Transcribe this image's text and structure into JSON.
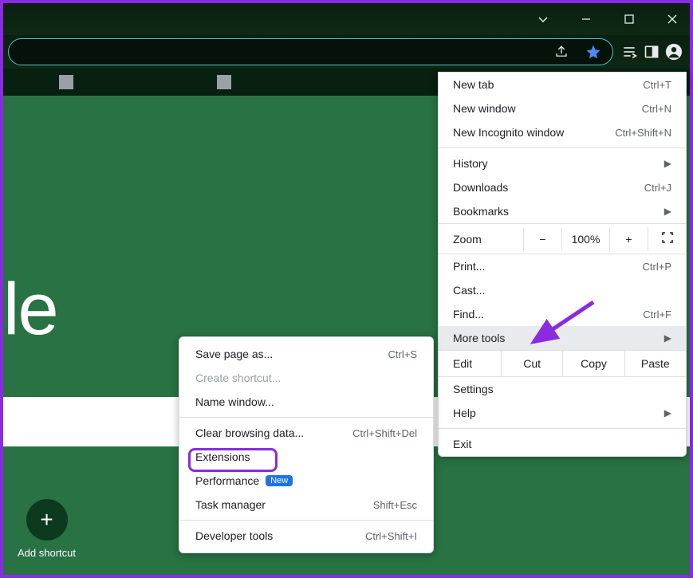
{
  "titlebar": {
    "controls": [
      "chevron-down",
      "minimize",
      "maximize",
      "close"
    ]
  },
  "toolbar": {
    "share_icon": "share-icon",
    "bookmark_icon": "star-icon",
    "reading_list_icon": "reading-list-icon",
    "side_panel_icon": "side-panel-icon",
    "profile_icon": "profile-icon",
    "menu_icon": "kebab-menu-icon"
  },
  "page": {
    "google_fragment": "le",
    "add_shortcut_label": "Add shortcut"
  },
  "main_menu": {
    "items": [
      {
        "label": "New tab",
        "shortcut": "Ctrl+T"
      },
      {
        "label": "New window",
        "shortcut": "Ctrl+N"
      },
      {
        "label": "New Incognito window",
        "shortcut": "Ctrl+Shift+N"
      }
    ],
    "history": {
      "label": "History"
    },
    "downloads": {
      "label": "Downloads",
      "shortcut": "Ctrl+J"
    },
    "bookmarks": {
      "label": "Bookmarks"
    },
    "zoom": {
      "label": "Zoom",
      "minus": "−",
      "value": "100%",
      "plus": "+"
    },
    "print": {
      "label": "Print...",
      "shortcut": "Ctrl+P"
    },
    "cast": {
      "label": "Cast..."
    },
    "find": {
      "label": "Find...",
      "shortcut": "Ctrl+F"
    },
    "more_tools": {
      "label": "More tools"
    },
    "edit": {
      "label": "Edit",
      "cut": "Cut",
      "copy": "Copy",
      "paste": "Paste"
    },
    "settings": {
      "label": "Settings"
    },
    "help": {
      "label": "Help"
    },
    "exit": {
      "label": "Exit"
    }
  },
  "submenu": {
    "save_page": {
      "label": "Save page as...",
      "shortcut": "Ctrl+S"
    },
    "create_shortcut": {
      "label": "Create shortcut..."
    },
    "name_window": {
      "label": "Name window..."
    },
    "clear_browsing": {
      "label": "Clear browsing data...",
      "shortcut": "Ctrl+Shift+Del"
    },
    "extensions": {
      "label": "Extensions"
    },
    "performance": {
      "label": "Performance",
      "badge": "New"
    },
    "task_manager": {
      "label": "Task manager",
      "shortcut": "Shift+Esc"
    },
    "dev_tools": {
      "label": "Developer tools",
      "shortcut": "Ctrl+Shift+I"
    }
  }
}
